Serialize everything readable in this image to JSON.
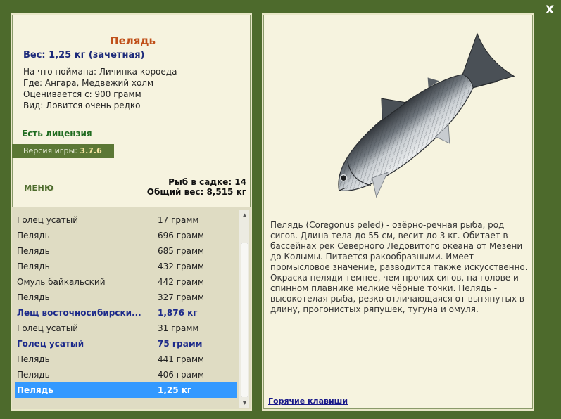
{
  "window": {
    "close_label": "X"
  },
  "fish": {
    "name": "Пелядь",
    "weight_line": "Вес: 1,25 кг (зачетная)",
    "caught_with": "На что поймана: Личинка короеда",
    "location": "Где: Ангара, Медвежий холм",
    "valued_from": "Оценивается с: 900 грамм",
    "rarity": "Вид: Ловится очень редко"
  },
  "license": "Есть лицензия",
  "version": {
    "label": "Версия игры:",
    "value": "3.7.6"
  },
  "menu_label": "МЕНЮ",
  "cage": {
    "count_label": "Рыб в садке: 14",
    "total_label": "Общий вес: 8,515 кг"
  },
  "catch_list": [
    {
      "name": "Голец усатый",
      "weight": "17 грамм",
      "style": "normal"
    },
    {
      "name": "Пелядь",
      "weight": "696 грамм",
      "style": "normal"
    },
    {
      "name": "Пелядь",
      "weight": "685 грамм",
      "style": "normal"
    },
    {
      "name": "Пелядь",
      "weight": "432 грамм",
      "style": "normal"
    },
    {
      "name": "Омуль байкальский",
      "weight": "442 грамм",
      "style": "normal"
    },
    {
      "name": "Пелядь",
      "weight": "327 грамм",
      "style": "normal"
    },
    {
      "name": "Лещ восточносибирски...",
      "weight": "1,876 кг",
      "style": "bold"
    },
    {
      "name": "Голец усатый",
      "weight": "31 грамм",
      "style": "normal"
    },
    {
      "name": "Голец усатый",
      "weight": "75 грамм",
      "style": "bold"
    },
    {
      "name": "Пелядь",
      "weight": "441 грамм",
      "style": "normal"
    },
    {
      "name": "Пелядь",
      "weight": "406 грамм",
      "style": "normal"
    },
    {
      "name": "Пелядь",
      "weight": "1,25 кг",
      "style": "selected"
    }
  ],
  "scrollbar": {
    "up_icon": "▲",
    "down_icon": "▼"
  },
  "description": "Пелядь (Coregonus peled) - озёрно-речная рыба, род сигов. Длина тела до 55 см, весит до 3 кг. Обитает в бассейнах рек Северного Ледовитого океана от Мезени до Колымы. Питается ракообразными. Имеет промысловое значение, разводится также искусственно. Окраска пеляди темнее, чем прочих сигов, на голове и спинном плавнике мелкие чёрные точки. Пелядь - высокотелая рыба, резко отличающаяся от вытянутых в длину, прогонистых ряпушек, тугуна и омуля.",
  "hotkeys_label": "Горячие клавиши",
  "colors": {
    "background": "#4d6a2c",
    "panel": "#f6f3df",
    "fish_name": "#c0501a",
    "weight": "#1c2a7a",
    "license": "#1f6b1f",
    "selected_row": "#3399ff"
  }
}
